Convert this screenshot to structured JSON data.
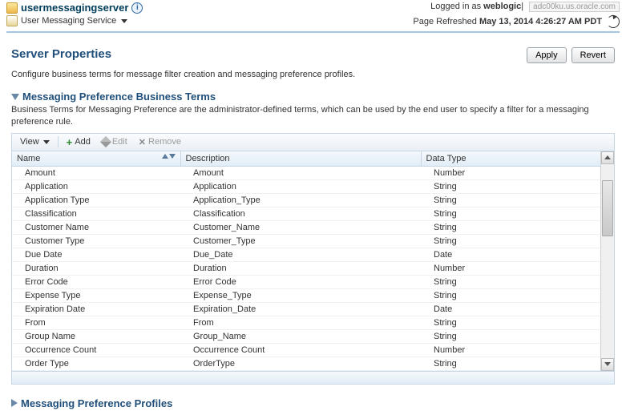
{
  "header": {
    "title": "usermessagingserver",
    "subtitle": "User Messaging Service",
    "logged_in_prefix": "Logged in as ",
    "logged_in_user": "weblogic",
    "host": "adc00ku.us.oracle.com",
    "refreshed_prefix": "Page Refreshed ",
    "refreshed_time": "May 13, 2014 4:26:27 AM PDT"
  },
  "page": {
    "title": "Server Properties",
    "description": "Configure business terms for message filter creation and messaging preference profiles.",
    "apply": "Apply",
    "revert": "Revert"
  },
  "terms_section": {
    "title": "Messaging Preference Business Terms",
    "description": "Business Terms for Messaging Preference are the administrator-defined terms, which can be used by the end user to specify a filter for a messaging preference rule."
  },
  "toolbar": {
    "view": "View",
    "add": "Add",
    "edit": "Edit",
    "remove": "Remove"
  },
  "columns": {
    "name": "Name",
    "description": "Description",
    "datatype": "Data Type"
  },
  "rows": [
    {
      "name": "Amount",
      "desc": "Amount",
      "type": "Number"
    },
    {
      "name": "Application",
      "desc": "Application",
      "type": "String"
    },
    {
      "name": "Application Type",
      "desc": "Application_Type",
      "type": "String"
    },
    {
      "name": "Classification",
      "desc": "Classification",
      "type": "String"
    },
    {
      "name": "Customer Name",
      "desc": "Customer_Name",
      "type": "String"
    },
    {
      "name": "Customer Type",
      "desc": "Customer_Type",
      "type": "String"
    },
    {
      "name": "Due Date",
      "desc": "Due_Date",
      "type": "Date"
    },
    {
      "name": "Duration",
      "desc": "Duration",
      "type": "Number"
    },
    {
      "name": "Error Code",
      "desc": "Error Code",
      "type": "String"
    },
    {
      "name": "Expense Type",
      "desc": "Expense_Type",
      "type": "String"
    },
    {
      "name": "Expiration Date",
      "desc": "Expiration_Date",
      "type": "Date"
    },
    {
      "name": "From",
      "desc": "From",
      "type": "String"
    },
    {
      "name": "Group Name",
      "desc": "Group_Name",
      "type": "String"
    },
    {
      "name": "Occurrence Count",
      "desc": "Occurrence Count",
      "type": "Number"
    },
    {
      "name": "Order Type",
      "desc": "OrderType",
      "type": "String"
    }
  ],
  "profiles_section": {
    "title": "Messaging Preference Profiles"
  }
}
